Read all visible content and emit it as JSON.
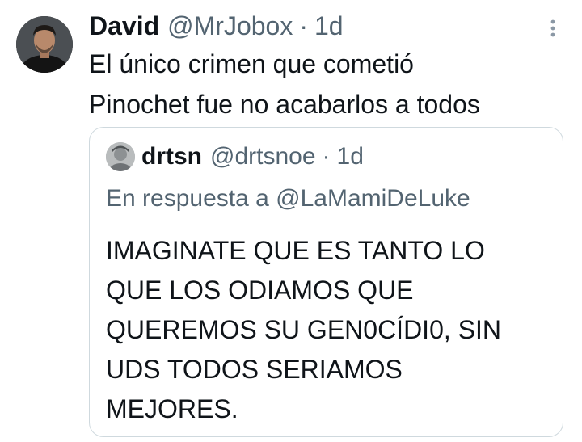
{
  "tweet": {
    "author_name": "David",
    "author_handle": "@MrJobox",
    "separator": "·",
    "time": "1d",
    "text_lines": [
      "El único crimen que cometió",
      "Pinochet fue no acabarlos a todos"
    ],
    "more_icon": "more-vertical-icon"
  },
  "quoted_tweet": {
    "author_name": "drtsn",
    "author_handle": "@drtsnoe",
    "separator": "·",
    "time": "1d",
    "reply_prefix": "En respuesta a",
    "reply_to": "@LaMamiDeLuke",
    "text_lines": [
      "IMAGINATE QUE ES TANTO LO",
      "QUE LOS ODIAMOS QUE",
      "QUEREMOS SU GEN0CÍDI0, SIN",
      "UDS TODOS SERIAMOS",
      "MEJORES."
    ]
  },
  "colors": {
    "primary_text": "#0f1419",
    "secondary_text": "#536471",
    "border": "#cfd9de",
    "background": "#ffffff"
  }
}
